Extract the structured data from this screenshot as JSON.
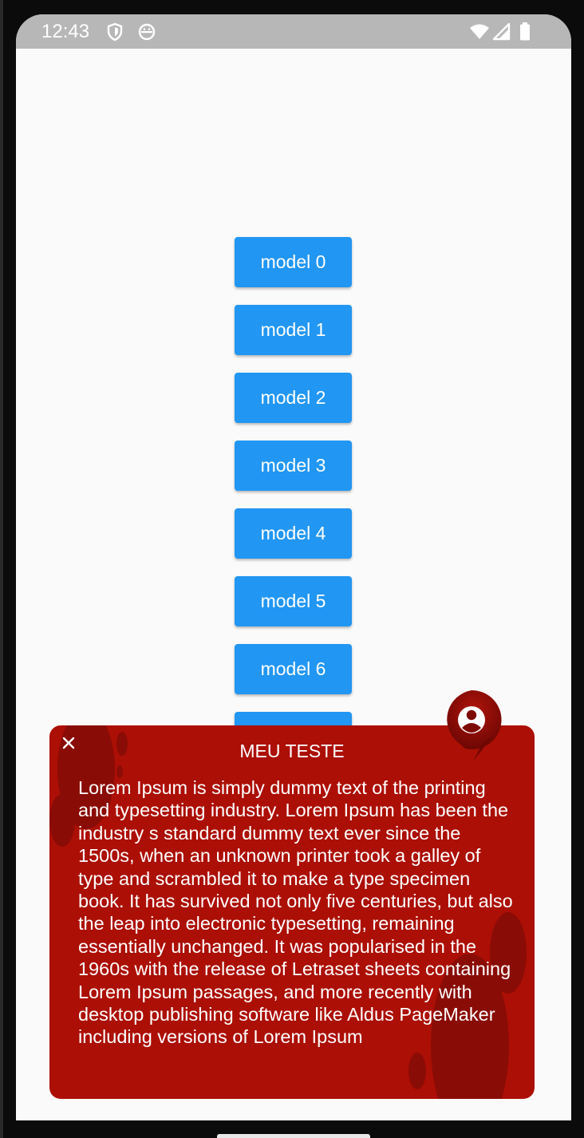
{
  "status_bar": {
    "time": "12:43",
    "icons": [
      "shield-icon",
      "android-debug-icon",
      "wifi-icon",
      "cellular-signal-icon",
      "battery-icon"
    ]
  },
  "buttons": [
    {
      "label": "model 0"
    },
    {
      "label": "model 1"
    },
    {
      "label": "model 2"
    },
    {
      "label": "model 3"
    },
    {
      "label": "model 4"
    },
    {
      "label": "model 5"
    },
    {
      "label": "model 6"
    }
  ],
  "popup": {
    "title": "MEU TESTE",
    "close_icon": "close-icon",
    "avatar_icon": "account-circle-icon",
    "body": "Lorem Ipsum is simply dummy text of the printing and typesetting industry. Lorem Ipsum has been the industry s standard dummy text ever since the 1500s, when an unknown printer took a galley of type and scrambled it to make a type specimen book. It has survived not only five centuries, but also the leap into electronic typesetting, remaining essentially unchanged. It was popularised in the 1960s with the release of Letraset sheets containing Lorem Ipsum passages, and more recently with desktop publishing software like Aldus PageMaker including versions of Lorem Ipsum"
  },
  "colors": {
    "button_blue": "#2196f3",
    "popup_red": "#ac0f05",
    "status_bar_grey": "#b7b7b7"
  }
}
